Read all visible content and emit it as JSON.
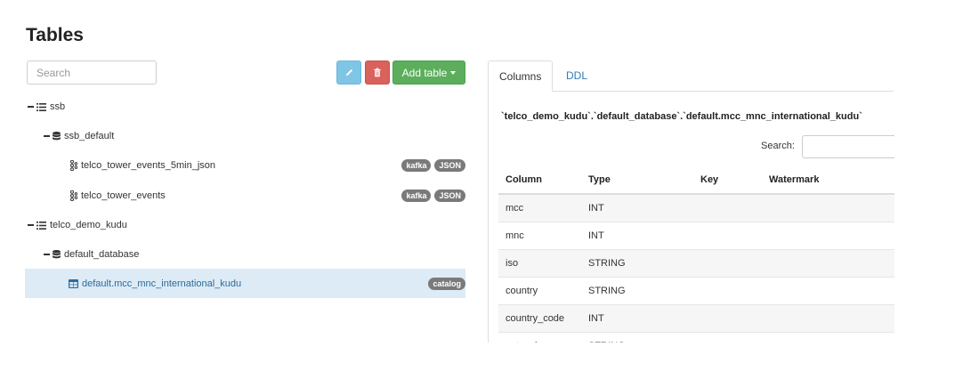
{
  "page": {
    "title": "Tables"
  },
  "toolbar": {
    "search_placeholder": "Search",
    "add_table_label": "Add table"
  },
  "tree": {
    "items": [
      {
        "label": "ssb"
      },
      {
        "label": "ssb_default"
      },
      {
        "label": "telco_tower_events_5min_json",
        "tags": [
          "kafka",
          "JSON"
        ]
      },
      {
        "label": "telco_tower_events",
        "tags": [
          "kafka",
          "JSON"
        ]
      },
      {
        "label": "telco_demo_kudu"
      },
      {
        "label": "default_database"
      },
      {
        "label": "default.mcc_mnc_international_kudu",
        "tags": [
          "catalog"
        ]
      }
    ]
  },
  "details": {
    "tabs": [
      "Columns",
      "DDL"
    ],
    "table_title": "`telco_demo_kudu`.`default_database`.`default.mcc_mnc_international_kudu`",
    "search_label": "Search:",
    "columns": [
      "Column",
      "Type",
      "Key",
      "Watermark"
    ],
    "rows": [
      {
        "column": "mcc",
        "type": "INT",
        "key": "",
        "watermark": ""
      },
      {
        "column": "mnc",
        "type": "INT",
        "key": "",
        "watermark": ""
      },
      {
        "column": "iso",
        "type": "STRING",
        "key": "",
        "watermark": ""
      },
      {
        "column": "country",
        "type": "STRING",
        "key": "",
        "watermark": ""
      },
      {
        "column": "country_code",
        "type": "INT",
        "key": "",
        "watermark": ""
      },
      {
        "column": "network",
        "type": "STRING",
        "key": "",
        "watermark": ""
      }
    ]
  },
  "colors": {
    "edit_button": "#7fc6e6",
    "delete_button": "#d9625c",
    "add_button": "#5cae5c",
    "selected_row": "#dcebf6",
    "link": "#337ab7",
    "badge": "#7a7a7a"
  }
}
